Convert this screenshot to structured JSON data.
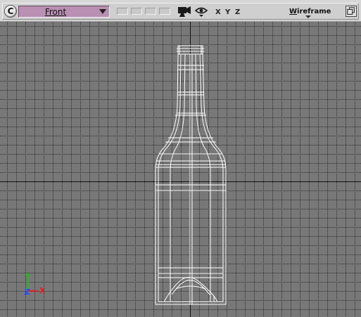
{
  "view_menu": {
    "glyph": "C"
  },
  "view_dropdown": {
    "label": "Front"
  },
  "layout_buttons": [
    "layout-1",
    "layout-2",
    "layout-3",
    "layout-4"
  ],
  "icons": {
    "camera": "camera-icon",
    "eye": "eye-icon"
  },
  "axes_buttons": {
    "x": "X",
    "y": "Y",
    "z": "Z"
  },
  "render_mode": {
    "first": "W",
    "rest": "ireframe"
  },
  "axis_triad": {
    "x": "X",
    "y": "Y",
    "z": "Z"
  },
  "colors": {
    "viewport_bg": "#787878",
    "grid_minor": "#2f2f2f",
    "grid_major": "#111111",
    "wireframe": "#ffffff",
    "dropdown_bg": "#b98fb3",
    "axis_x": "#e02020",
    "axis_y": "#19c019",
    "axis_z": "#2a4dff"
  }
}
